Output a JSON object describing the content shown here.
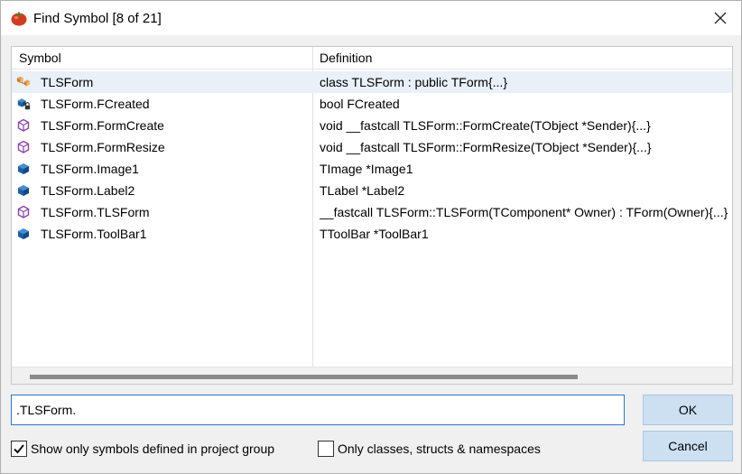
{
  "window": {
    "title": "Find Symbol [8 of 21]",
    "app_icon": "tomato-icon",
    "close_icon": "close-icon"
  },
  "list": {
    "columns": [
      "Symbol",
      "Definition"
    ],
    "selected_index": 0,
    "rows": [
      {
        "icon": "class-icon",
        "symbol": "TLSForm",
        "definition": "class TLSForm : public TForm{...}"
      },
      {
        "icon": "private-field-icon",
        "symbol": "TLSForm.FCreated",
        "definition": "bool FCreated"
      },
      {
        "icon": "method-icon",
        "symbol": "TLSForm.FormCreate",
        "definition": "void __fastcall TLSForm::FormCreate(TObject *Sender){...}"
      },
      {
        "icon": "method-icon",
        "symbol": "TLSForm.FormResize",
        "definition": "void __fastcall TLSForm::FormResize(TObject *Sender){...}"
      },
      {
        "icon": "field-icon",
        "symbol": "TLSForm.Image1",
        "definition": "TImage *Image1"
      },
      {
        "icon": "field-icon",
        "symbol": "TLSForm.Label2",
        "definition": "TLabel *Label2"
      },
      {
        "icon": "method-icon",
        "symbol": "TLSForm.TLSForm",
        "definition": "__fastcall TLSForm::TLSForm(TComponent* Owner) : TForm(Owner){...}"
      },
      {
        "icon": "field-icon",
        "symbol": "TLSForm.ToolBar1",
        "definition": "TToolBar *ToolBar1"
      }
    ]
  },
  "search": {
    "value": ".TLSForm."
  },
  "buttons": {
    "ok": "OK",
    "cancel": "Cancel"
  },
  "options": {
    "project_group": {
      "label": "Show only symbols defined in project group",
      "checked": true
    },
    "classes_only": {
      "label": "Only classes, structs & namespaces",
      "checked": false
    }
  },
  "colors": {
    "selection": "#e9f0f8",
    "button_bg": "#cce0f2",
    "focus_border": "#2a78c8"
  }
}
